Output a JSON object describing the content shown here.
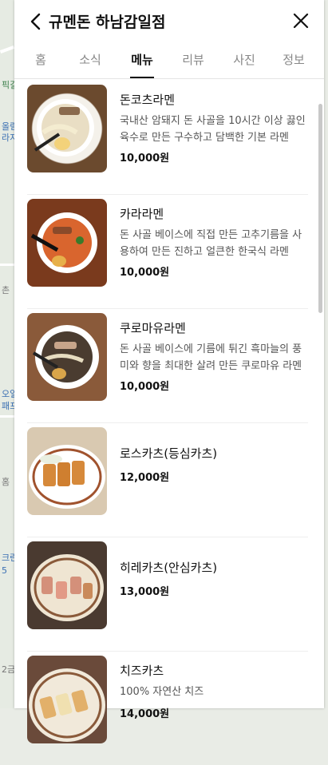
{
  "header": {
    "title": "규멘돈 하남감일점"
  },
  "tabs": [
    {
      "label": "홈"
    },
    {
      "label": "소식"
    },
    {
      "label": "메뉴"
    },
    {
      "label": "리뷰"
    },
    {
      "label": "사진"
    },
    {
      "label": "정보"
    }
  ],
  "active_tab": "메뉴",
  "menu": [
    {
      "name": "돈코츠라멘",
      "desc": "국내산 암돼지 돈 사골을 10시간 이상 끓인 육수로 만든 구수하고 담백한 기본 라멘",
      "price": "10,000원"
    },
    {
      "name": "카라라멘",
      "desc": "돈 사골 베이스에 직접 만든 고추기름을 사용하여 만든 진하고 얼큰한 한국식 라멘",
      "price": "10,000원"
    },
    {
      "name": "쿠로마유라멘",
      "desc": "돈 사골 베이스에 기름에 튀긴 흑마늘의 풍미와 향을 최대한 살려 만든 쿠로마유 라멘",
      "price": "10,000원"
    },
    {
      "name": "로스카츠(등심카츠)",
      "desc": "",
      "price": "12,000원"
    },
    {
      "name": "히레카츠(안심카츠)",
      "desc": "",
      "price": "13,000원"
    },
    {
      "name": "치즈카츠",
      "desc": "100% 자연산 치즈",
      "price": "14,000원"
    }
  ],
  "map_labels": [
    "픽길",
    "올림",
    "라지",
    "촌",
    "오일",
    "패프",
    "홈",
    "크린",
    "5",
    "2금"
  ],
  "colors": {
    "accent": "#111111",
    "muted": "#888888",
    "map_green": "#3b7f4a"
  }
}
